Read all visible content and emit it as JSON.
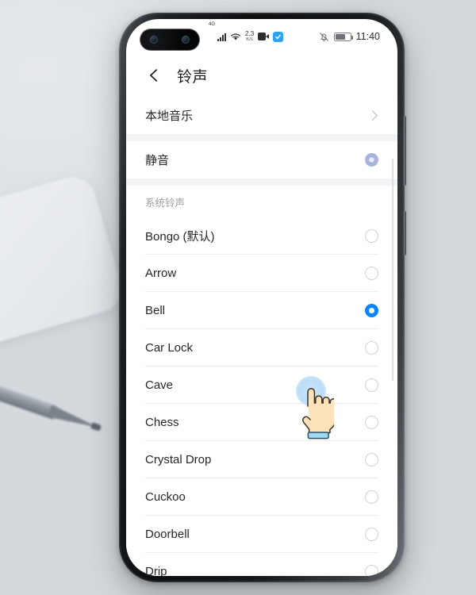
{
  "statusbar": {
    "signal_label": "4G",
    "net_speed_value": "2.3",
    "net_speed_unit": "K/s",
    "time": "11:40",
    "icons": [
      "signal-bars-icon",
      "wifi-icon",
      "network-speed",
      "video-camera-icon",
      "app-badge-icon",
      "bell-off-icon",
      "battery-icon"
    ]
  },
  "appbar": {
    "back_icon": "back-arrow-icon",
    "title": "铃声"
  },
  "local_music": {
    "label": "本地音乐",
    "chevron": "chevron-right-icon"
  },
  "silent": {
    "label": "静音",
    "state": "pressed"
  },
  "section": {
    "header": "系统铃声"
  },
  "ringtones": [
    {
      "label": "Bongo (默认)",
      "selected": false
    },
    {
      "label": "Arrow",
      "selected": false
    },
    {
      "label": "Bell",
      "selected": true
    },
    {
      "label": "Car Lock",
      "selected": false
    },
    {
      "label": "Cave",
      "selected": false
    },
    {
      "label": "Chess",
      "selected": false
    },
    {
      "label": "Crystal Drop",
      "selected": false
    },
    {
      "label": "Cuckoo",
      "selected": false
    },
    {
      "label": "Doorbell",
      "selected": false
    },
    {
      "label": "Drip",
      "selected": false
    }
  ],
  "cursor": {
    "type": "tap-hand-cursor",
    "target": "Bell"
  },
  "colors": {
    "accent_blue": "#0a84ff",
    "pressed_radio": "#9aa6d8",
    "divider": "#ececec",
    "section_text": "#9a9da1",
    "background": "#ffffff",
    "desk": "#d8dce0"
  }
}
